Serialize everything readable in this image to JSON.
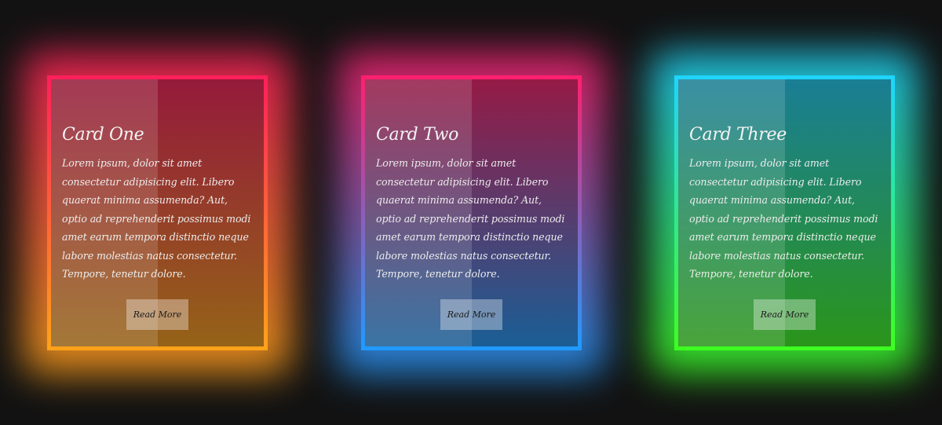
{
  "cards": [
    {
      "title": "Card One",
      "text": "Lorem ipsum, dolor sit amet consectetur adipisicing elit. Libero quaerat minima assumenda? Aut, optio ad reprehenderit possimus modi amet earum tempora distinctio neque labore molestias natus consectetur. Tempore, tenetur dolore.",
      "button": "Read More",
      "gradient_start": "#ff1f5a",
      "gradient_end": "#ffa31a"
    },
    {
      "title": "Card Two",
      "text": "Lorem ipsum, dolor sit amet consectetur adipisicing elit. Libero quaerat minima assumenda? Aut, optio ad reprehenderit possimus modi amet earum tempora distinctio neque labore molestias natus consectetur. Tempore, tenetur dolore.",
      "button": "Read More",
      "gradient_start": "#ff1f6e",
      "gradient_end": "#1f9bff"
    },
    {
      "title": "Card Three",
      "text": "Lorem ipsum, dolor sit amet consectetur adipisicing elit. Libero quaerat minima assumenda? Aut, optio ad reprehenderit possimus modi amet earum tempora distinctio neque labore molestias natus consectetur. Tempore, tenetur dolore.",
      "button": "Read More",
      "gradient_start": "#1fd4ff",
      "gradient_end": "#3dff1f"
    }
  ]
}
